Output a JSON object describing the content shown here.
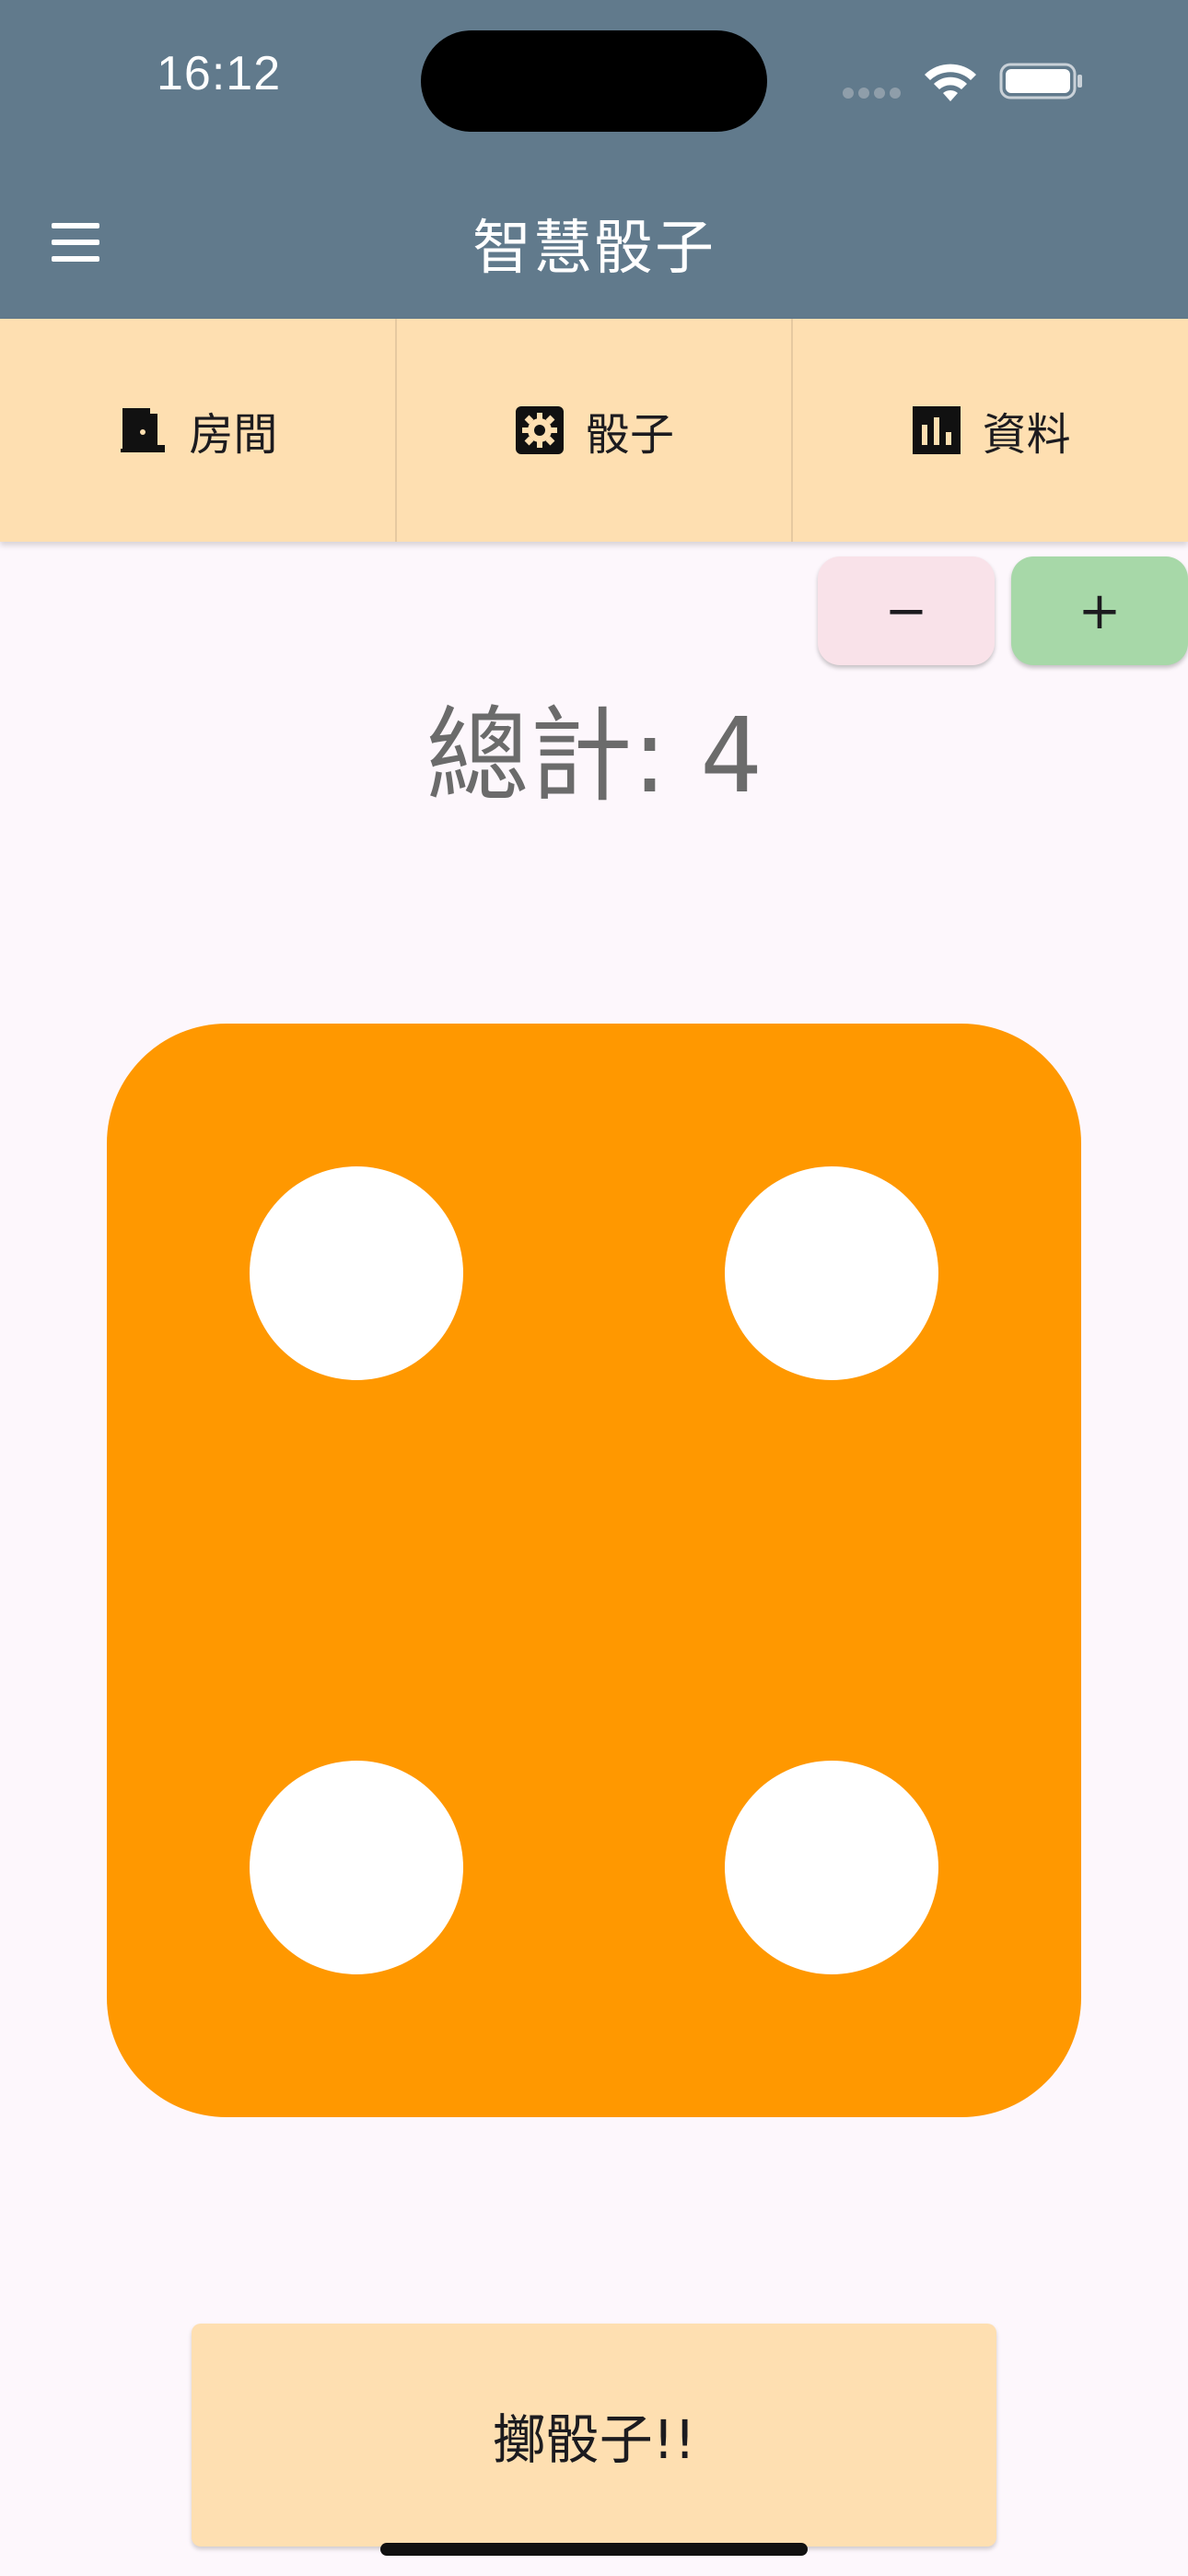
{
  "status_bar": {
    "time": "16:12"
  },
  "app_bar": {
    "title": "智慧骰子",
    "background": "#617a8c"
  },
  "tabs": [
    {
      "label": "房間",
      "icon": "door-icon"
    },
    {
      "label": "骰子",
      "icon": "gear-icon"
    },
    {
      "label": "資料",
      "icon": "bar-chart-icon"
    }
  ],
  "stepper": {
    "minus_label": "−",
    "plus_label": "+"
  },
  "total": {
    "label": "總計: ",
    "value": "4"
  },
  "die": {
    "face_value": 4,
    "color": "#ff9800",
    "pip_color": "#ffffff"
  },
  "roll_button": {
    "label": "擲骰子!!"
  },
  "colors": {
    "tab_background": "#fedfb1",
    "page_background": "#fdf7fc",
    "minus_button": "#f9e2e9",
    "plus_button": "#a7d8a8"
  }
}
